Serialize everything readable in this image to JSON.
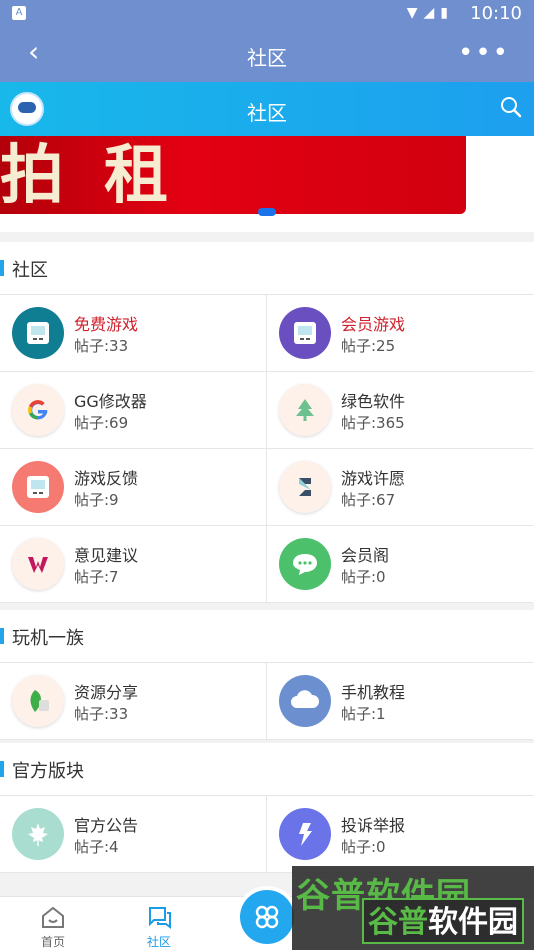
{
  "status_bar": {
    "time": "10:10",
    "icons": [
      "wifi-icon",
      "signal-icon",
      "battery-icon"
    ]
  },
  "app_bar": {
    "title": "社区",
    "back_icon": "back-arrow-icon",
    "more_icon": "more-dots-icon"
  },
  "sub_bar": {
    "title": "社区",
    "search_icon": "search-icon"
  },
  "banner": {
    "text": "拍租",
    "indicator": "active"
  },
  "sections": [
    {
      "title": "社区",
      "items": [
        {
          "name": "免费游戏",
          "count": "帖子:33",
          "color": "#0f7d92",
          "icon": "gameboy-icon",
          "highlight": true
        },
        {
          "name": "会员游戏",
          "count": "帖子:25",
          "color": "#6a4fc0",
          "icon": "gameboy-icon",
          "highlight": true
        },
        {
          "name": "GG修改器",
          "count": "帖子:69",
          "color": "#fdf1ea",
          "icon": "google-g-icon",
          "highlight": false
        },
        {
          "name": "绿色软件",
          "count": "帖子:365",
          "color": "#fdf1ea",
          "icon": "tree-icon",
          "highlight": false
        },
        {
          "name": "游戏反馈",
          "count": "帖子:9",
          "color": "#f47a72",
          "icon": "gameboy-icon",
          "highlight": false
        },
        {
          "name": "游戏许愿",
          "count": "帖子:67",
          "color": "#fdf1ea",
          "icon": "s-logo-icon",
          "highlight": false
        },
        {
          "name": "意见建议",
          "count": "帖子:7",
          "color": "#fdf1ea",
          "icon": "w-logo-icon",
          "highlight": false
        },
        {
          "name": "会员阁",
          "count": "帖子:0",
          "color": "#4cc06b",
          "icon": "chat-icon",
          "highlight": false
        }
      ]
    },
    {
      "title": "玩机一族",
      "items": [
        {
          "name": "资源分享",
          "count": "帖子:33",
          "color": "#fdf1ea",
          "icon": "leaf-icon",
          "highlight": false
        },
        {
          "name": "手机教程",
          "count": "帖子:1",
          "color": "#6b8fcf",
          "icon": "cloud-icon",
          "highlight": false
        }
      ]
    },
    {
      "title": "官方版块",
      "items": [
        {
          "name": "官方公告",
          "count": "帖子:4",
          "color": "#a9ddd0",
          "icon": "maple-leaf-icon",
          "highlight": false
        },
        {
          "name": "投诉举报",
          "count": "帖子:0",
          "color": "#6a74e8",
          "icon": "lightning-icon",
          "highlight": false
        }
      ]
    }
  ],
  "tab_bar": {
    "tabs": [
      {
        "label": "首页",
        "icon": "home-icon",
        "active": false
      },
      {
        "label": "社区",
        "icon": "community-chat-icon",
        "active": true
      }
    ],
    "fab_icon": "grid-dots-icon"
  },
  "watermark": {
    "line1": "谷普软件园",
    "line2_a": "谷普",
    "line2_b": "软件园"
  }
}
